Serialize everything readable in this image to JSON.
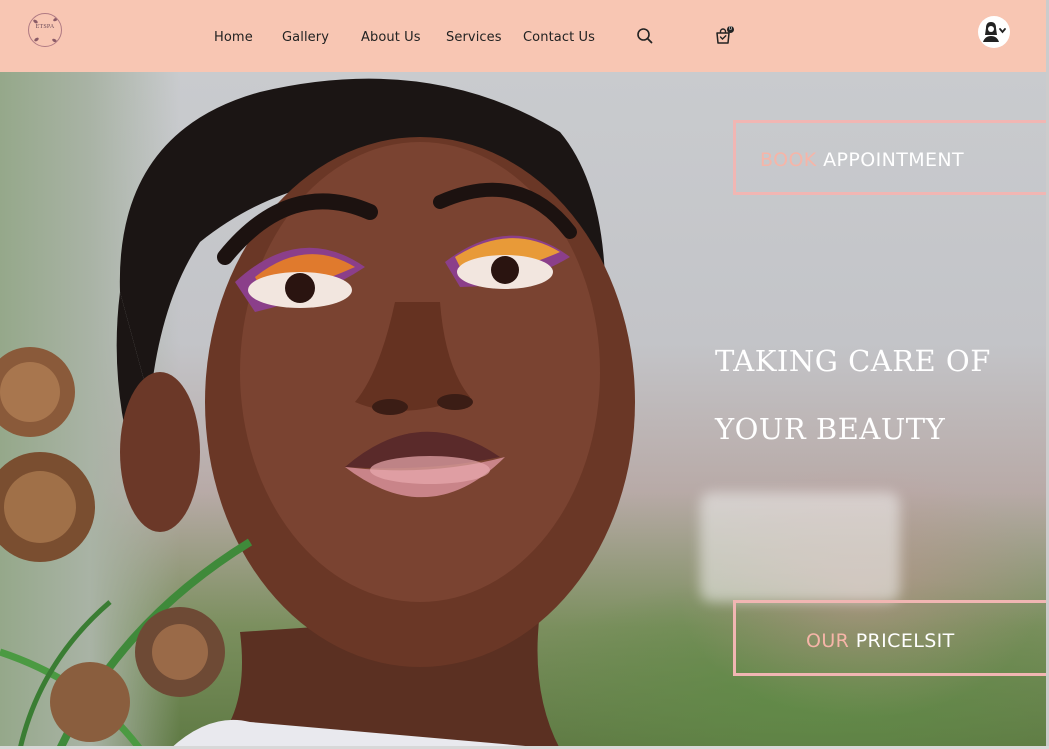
{
  "brand": {
    "logo_text": "ETSPA"
  },
  "nav": {
    "items": [
      {
        "label": "Home"
      },
      {
        "label": "Gallery"
      },
      {
        "label": "About Us"
      },
      {
        "label": "Services"
      },
      {
        "label": "Contact Us"
      }
    ]
  },
  "header_icons": {
    "search": "search-icon",
    "cart": "shopping-bag-icon",
    "cart_count": "0",
    "account": "user-avatar-icon"
  },
  "hero": {
    "headline_line1": "TAKING CARE OF",
    "headline_line2": "YOUR BEAUTY",
    "book_button": {
      "accent": "BOOK",
      "main": "APPOINTMENT"
    },
    "price_button": {
      "accent": "OUR",
      "main": "PRICELSIT"
    }
  },
  "colors": {
    "header_bg": "#f8c6b3",
    "button_border": "#f1b6b3",
    "button_accent_text": "#f6b5a8",
    "button_main_text": "#ffffff"
  }
}
